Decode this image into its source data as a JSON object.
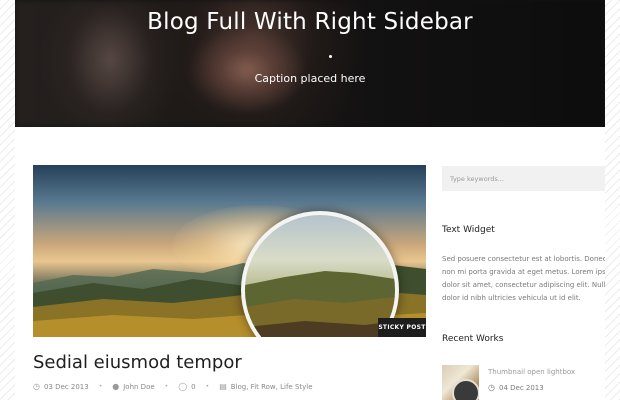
{
  "hero": {
    "title": "Blog Full With Right Sidebar",
    "caption": "Caption placed here"
  },
  "post": {
    "badge": "STICKY POST",
    "title": "Sedial eiusmod tempor",
    "meta": {
      "date": "03 Dec 2013",
      "author": "John Doe",
      "comments": "0",
      "categories": "Blog, Fit Row, Life Style"
    }
  },
  "sidebar": {
    "search_placeholder": "Type keywords...",
    "text_widget": {
      "title": "Text Widget",
      "lines": [
        "Sed posuere consectetur est at lobortis. Donec id",
        "non mi porta gravida at eget metus. Lorem ipsu",
        "dolor sit amet, consectetur adipiscing elit. Nulla",
        "dolor id nibh ultricies vehicula ut id elit."
      ]
    },
    "recent_works": {
      "title": "Recent Works",
      "items": [
        {
          "title": "Thumbnail open lightbox",
          "date": "04 Dec 2013"
        }
      ]
    }
  },
  "icons": {
    "date": "clock-icon",
    "author": "user-icon",
    "comments": "comment-icon",
    "categories": "folder-icon"
  }
}
